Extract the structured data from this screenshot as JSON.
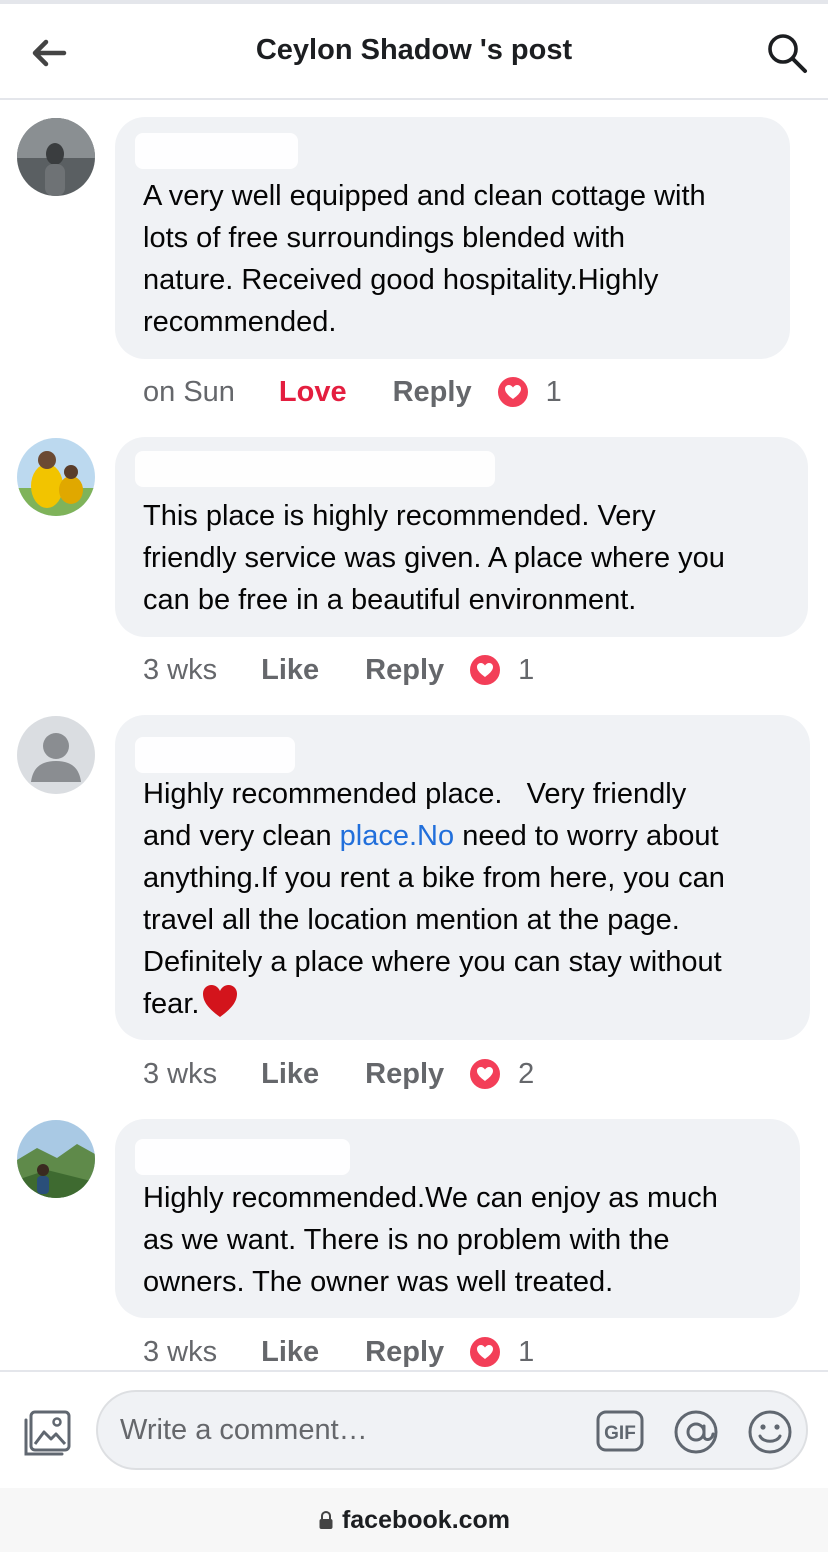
{
  "header": {
    "title": "Ceylon Shadow 's post"
  },
  "comments": [
    {
      "text": "A very well equipped and clean cottage with\nlots of free surroundings blended with\nnature. Received good hospitality.Highly\nrecommended.",
      "time": "on Sun",
      "like_label": "Love",
      "reply_label": "Reply",
      "reaction_count": "1"
    },
    {
      "text": "This place is highly recommended. Very\nfriendly service was given. A place where you\ncan be free in a beautiful environment.",
      "time": "3 wks",
      "like_label": "Like",
      "reply_label": "Reply",
      "reaction_count": "1"
    },
    {
      "text_before_link": "Highly recommended place.   Very friendly\nand very clean ",
      "link_text": "place.No",
      "text_after_link": " need to worry about\nanything.If you rent a bike from here, you can\ntravel all the location mention at the page.\nDefinitely a place where you can stay without\nfear.",
      "time": "3 wks",
      "like_label": "Like",
      "reply_label": "Reply",
      "reaction_count": "2"
    },
    {
      "text": "Highly recommended.We can enjoy as much\nas we want. There is no problem with the\nowners. The owner was well treated.",
      "time": "3 wks",
      "like_label": "Like",
      "reply_label": "Reply",
      "reaction_count": "1"
    }
  ],
  "composer": {
    "placeholder": "Write a comment…",
    "gif_label": "GIF"
  },
  "browser": {
    "url": "facebook.com"
  },
  "icons": [
    "back-arrow-icon",
    "search-icon",
    "heart-reaction-icon",
    "red-heart-emoji-icon",
    "photo-icon",
    "gif-icon",
    "at-mention-icon",
    "emoji-icon",
    "lock-icon"
  ],
  "colors": {
    "bubble": "#f0f2f5",
    "meta_text": "#65676b",
    "love_red": "#e41e3f",
    "heart_badge": "#f33e58",
    "link_blue": "#216fdb"
  }
}
